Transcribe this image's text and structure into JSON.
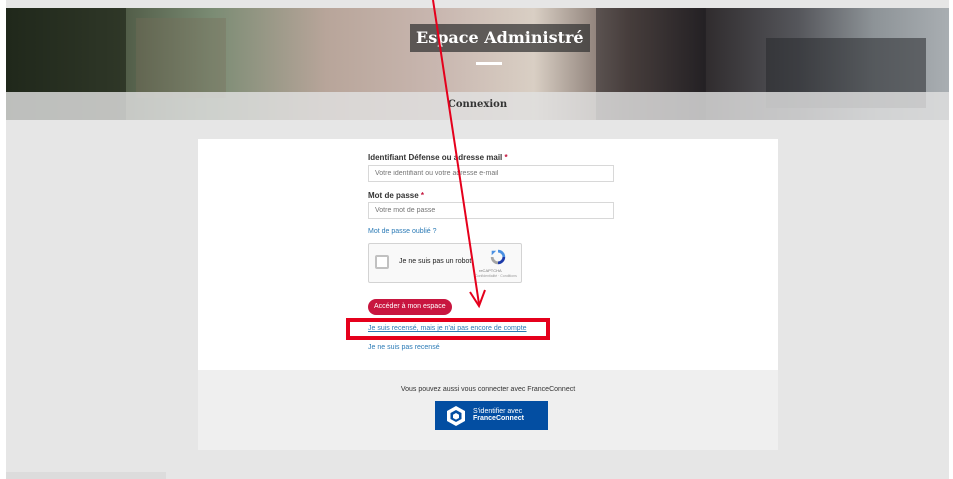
{
  "header": {
    "title": "Espace Administré",
    "subtitle": "Connexion"
  },
  "form": {
    "identifier_label": "Identifiant Défense ou adresse mail",
    "identifier_required": "*",
    "identifier_placeholder": "Votre identifiant ou votre adresse e-mail",
    "password_label": "Mot de passe",
    "password_required": "*",
    "password_placeholder": "Votre mot de passe",
    "forgot_password": "Mot de passe oublié ?",
    "captcha_text": "Je ne suis pas un robot",
    "captcha_brand": "reCAPTCHA",
    "captcha_terms": "Confidentialité · Conditions",
    "submit_label": "Accéder à mon espace",
    "census_no_account_link": "Je suis recensé, mais je n'ai pas encore de compte",
    "not_census_link": "Je ne suis pas recensé"
  },
  "franceconnect": {
    "prompt": "Vous pouvez aussi vous connecter avec FranceConnect",
    "button_line1": "S'identifier avec",
    "button_line2": "FranceConnect"
  },
  "colors": {
    "accent": "#c8163f",
    "link": "#2c7bb6",
    "franceconnect": "#034ea2",
    "annotation": "#e5001c"
  }
}
